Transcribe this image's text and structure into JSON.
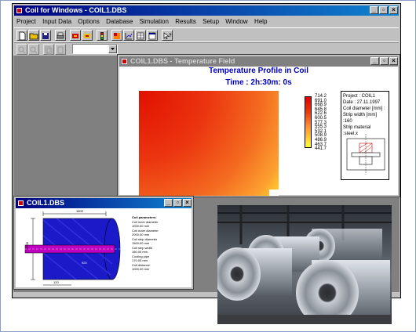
{
  "app": {
    "title": "Coil for Windows - COIL1.DBS",
    "menu": [
      "Project",
      "Input Data",
      "Options",
      "Database",
      "Simulation",
      "Results",
      "Setup",
      "Window",
      "Help"
    ],
    "combo_value": ""
  },
  "temp_window": {
    "title": "COIL1.DBS - Temperature Field",
    "heading": "Temperature Profile in Coil",
    "time_label": "Time : 2h:30m: 0s",
    "legend": [
      "714.2",
      "691.0",
      "668.9",
      "645.8",
      "622.6",
      "600.5",
      "577.3",
      "555.3",
      "532.1",
      "508.9",
      "486.9",
      "463.7",
      "441.7"
    ],
    "legend_colors": [
      "#e00000",
      "#e41608",
      "#e82c10",
      "#ec4218",
      "#f05a20",
      "#f47028",
      "#f88630",
      "#fc9c38",
      "#ffb238",
      "#ffc830",
      "#ffdc28",
      "#fff020",
      "#ffff30"
    ],
    "info": {
      "project": "Project : COIL1",
      "date": "Date : 27.11.1997",
      "coil_diameter": "Coil diameter [mm] :",
      "strip_width": "Strip width [mm] :160",
      "strip_material": "Strip material :steel.x"
    }
  },
  "coil_window": {
    "title": "COIL1.DBS",
    "dim_top": "1800",
    "dim_left": "1500",
    "dim_bottom": "120",
    "center_label": "920",
    "annotations": [
      "Coil parameters:",
      "Coil inner diameter",
      "1000.00 mm",
      "Coil outer diameter",
      "2000.00 mm",
      "Coil strip diameter",
      "1500.00 mm",
      "Coil strip width",
      "160.00 mm",
      "Cooling pipe",
      "170.00 mm",
      "Coil distance",
      "1000.00 mm"
    ]
  }
}
